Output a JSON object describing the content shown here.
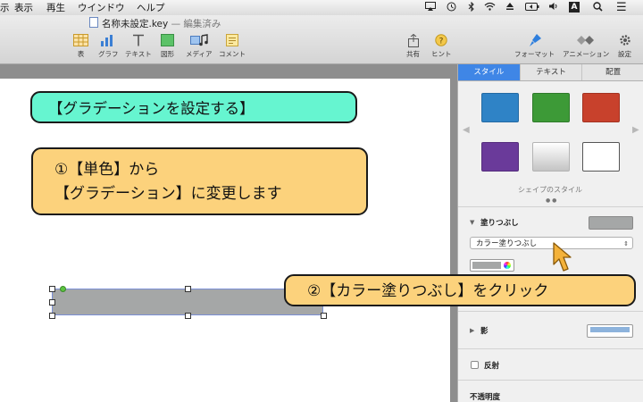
{
  "menubar": {
    "items": [
      "示",
      "表示",
      "再生",
      "ウインドウ",
      "ヘルプ"
    ],
    "tray": {
      "input_label": "A",
      "menu_glyph": "☰"
    }
  },
  "document": {
    "title": "名称未設定.key",
    "status": "— 編集済み"
  },
  "toolbar": {
    "items": [
      {
        "label": "表",
        "icon": "table-icon"
      },
      {
        "label": "グラフ",
        "icon": "chart-icon"
      },
      {
        "label": "テキスト",
        "icon": "text-icon"
      },
      {
        "label": "図形",
        "icon": "shape-icon"
      },
      {
        "label": "メディア",
        "icon": "media-icon"
      },
      {
        "label": "コメント",
        "icon": "comment-icon"
      }
    ],
    "right_items": [
      {
        "label": "共有",
        "icon": "share-icon"
      },
      {
        "label": "ヒント",
        "icon": "tips-icon"
      },
      {
        "label": "フォーマット",
        "icon": "format-icon"
      },
      {
        "label": "アニメーション",
        "icon": "animate-icon"
      },
      {
        "label": "設定",
        "icon": "setup-icon"
      }
    ]
  },
  "slide": {
    "callout_title": "【グラデーションを設定する】",
    "callout_step1_line1": "①【単色】から",
    "callout_step1_line2": "【グラデーション】に変更します",
    "callout_step2": "②【カラー塗りつぶし】をクリック"
  },
  "inspector": {
    "tabs": [
      "スタイル",
      "テキスト",
      "配置"
    ],
    "active_tab": "スタイル",
    "shape_styles_label": "シェイプのスタイル",
    "styles": [
      {
        "name": "blue",
        "color": "#2f83c6"
      },
      {
        "name": "green",
        "color": "#3d9a37"
      },
      {
        "name": "red",
        "color": "#c8412c"
      },
      {
        "name": "purple",
        "color": "#6a3a9a"
      },
      {
        "name": "gradient-white",
        "color": "#e6e6e6"
      },
      {
        "name": "outline",
        "color": "#ffffff"
      }
    ],
    "fill_label": "塗りつぶし",
    "fill_type": "カラー塗りつぶし",
    "fill_color": "#a5a7a7",
    "shadow_label": "影",
    "reflection_label": "反射",
    "opacity_label": "不透明度"
  },
  "colors": {
    "accent": "#3f86e6",
    "callout_teal": "#66f5d0",
    "callout_orange": "#fcd27c"
  }
}
